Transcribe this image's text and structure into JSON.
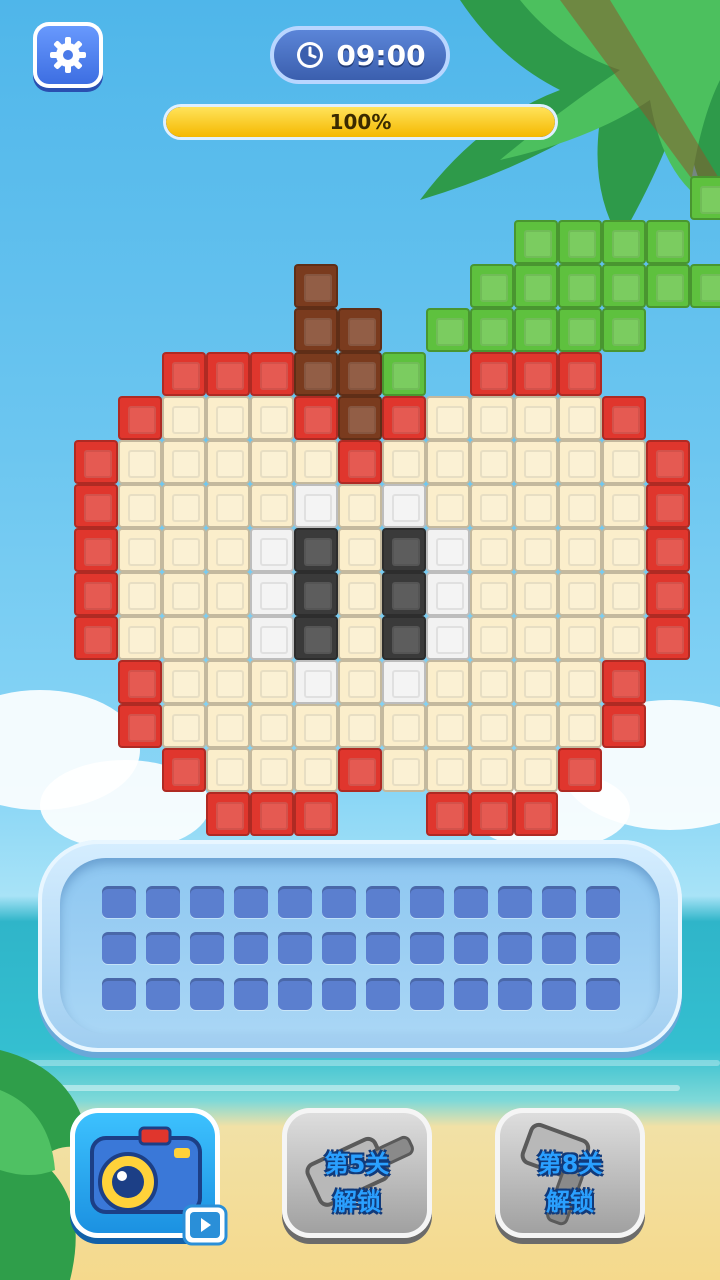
{
  "hud": {
    "timer_text": "09:00",
    "progress_text": "100%",
    "progress_fraction": 1.0
  },
  "icons": {
    "settings": "gear-icon",
    "timer": "clock-icon",
    "camera": "camera-icon",
    "video": "video-icon",
    "hammer": "hammer-icon"
  },
  "buttons": {
    "lock_a_line1": "第5关",
    "lock_a_line2": "解锁",
    "lock_b_line1": "第8关",
    "lock_b_line2": "解锁"
  },
  "tray": {
    "rows": 3,
    "cols": 12
  },
  "colors": {
    "R": "#e0362d",
    "C": "#fbeecb",
    "W": "#f2f2f2",
    "K": "#3a3a3a",
    "B": "#7a3b1e",
    "G": "#5ec13e"
  },
  "puzzle_rows": [
    "..............G",
    "..........GGGG.",
    ".....B...GGGGGG",
    ".....BB.GGGGG..",
    "..RRRBBG.RRR...",
    ".RCCCRBRCCCCR..",
    "RCCCCCRCCCCCCR.",
    "RCCCCWCWCCCCCR.",
    "RCCCWKCKWCCCCR.",
    "RCCCWKCKWCCCCR.",
    "RCCCWKCKWCCCCR.",
    ".RCCCWCWCCCCR..",
    ".RCCCCCCCCCCR..",
    "..RCCCRCCCCR...",
    "...RRR..RRR...."
  ]
}
